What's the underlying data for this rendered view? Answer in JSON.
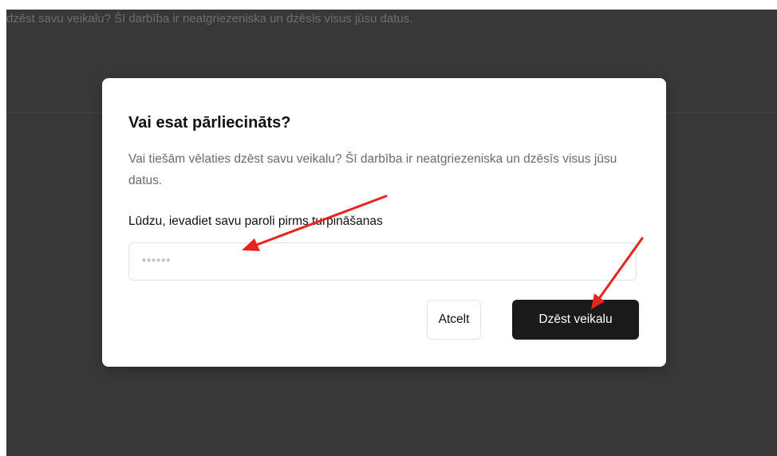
{
  "background": {
    "text": "dzēst savu veikalu? Šī darbība ir neatgriezeniska un dzēsīs visus jūsu datus."
  },
  "modal": {
    "title": "Vai esat pārliecināts?",
    "description": "Vai tiešām vēlaties dzēst savu veikalu? Šī darbība ir neatgriezeniska un dzēsīs visus jūsu datus.",
    "password_label": "Lūdzu, ievadiet savu paroli pirms turpināšanas",
    "password_placeholder": "******",
    "cancel_label": "Atcelt",
    "delete_label": "Dzēst veikalu"
  },
  "colors": {
    "overlay": "#383838",
    "primary_button": "#1a1a1a",
    "annotation_arrow": "#e8241e"
  },
  "annotations": {
    "arrow_icon": "red-arrow-icon",
    "count": 2
  }
}
